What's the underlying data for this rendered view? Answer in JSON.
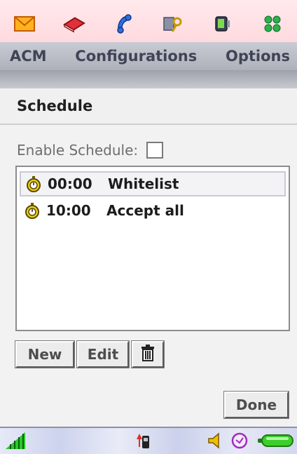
{
  "icon_bar": {
    "icons": [
      "envelope-icon",
      "book-icon",
      "phone-handset-icon",
      "key-card-icon",
      "device-icon",
      "apps-grid-icon"
    ]
  },
  "menu": {
    "items": [
      "ACM",
      "Configurations",
      "Options"
    ]
  },
  "screen": {
    "title": "Schedule",
    "enable_label": "Enable Schedule:",
    "enable_checked": false
  },
  "schedule_list": [
    {
      "time": "00:00",
      "label": "Whitelist",
      "selected": true
    },
    {
      "time": "10:00",
      "label": "Accept all",
      "selected": false
    }
  ],
  "buttons": {
    "new": "New",
    "edit": "Edit",
    "delete_icon": "trash-icon",
    "done": "Done"
  },
  "status_bar": {
    "icons": [
      "signal-strength-icon",
      "phone-call-icon",
      "speaker-icon",
      "clock-icon",
      "battery-icon"
    ]
  },
  "colors": {
    "menu_text": "#3f4456",
    "selection_border": "#c8cad6",
    "battery_green": "#3bcf2c"
  }
}
